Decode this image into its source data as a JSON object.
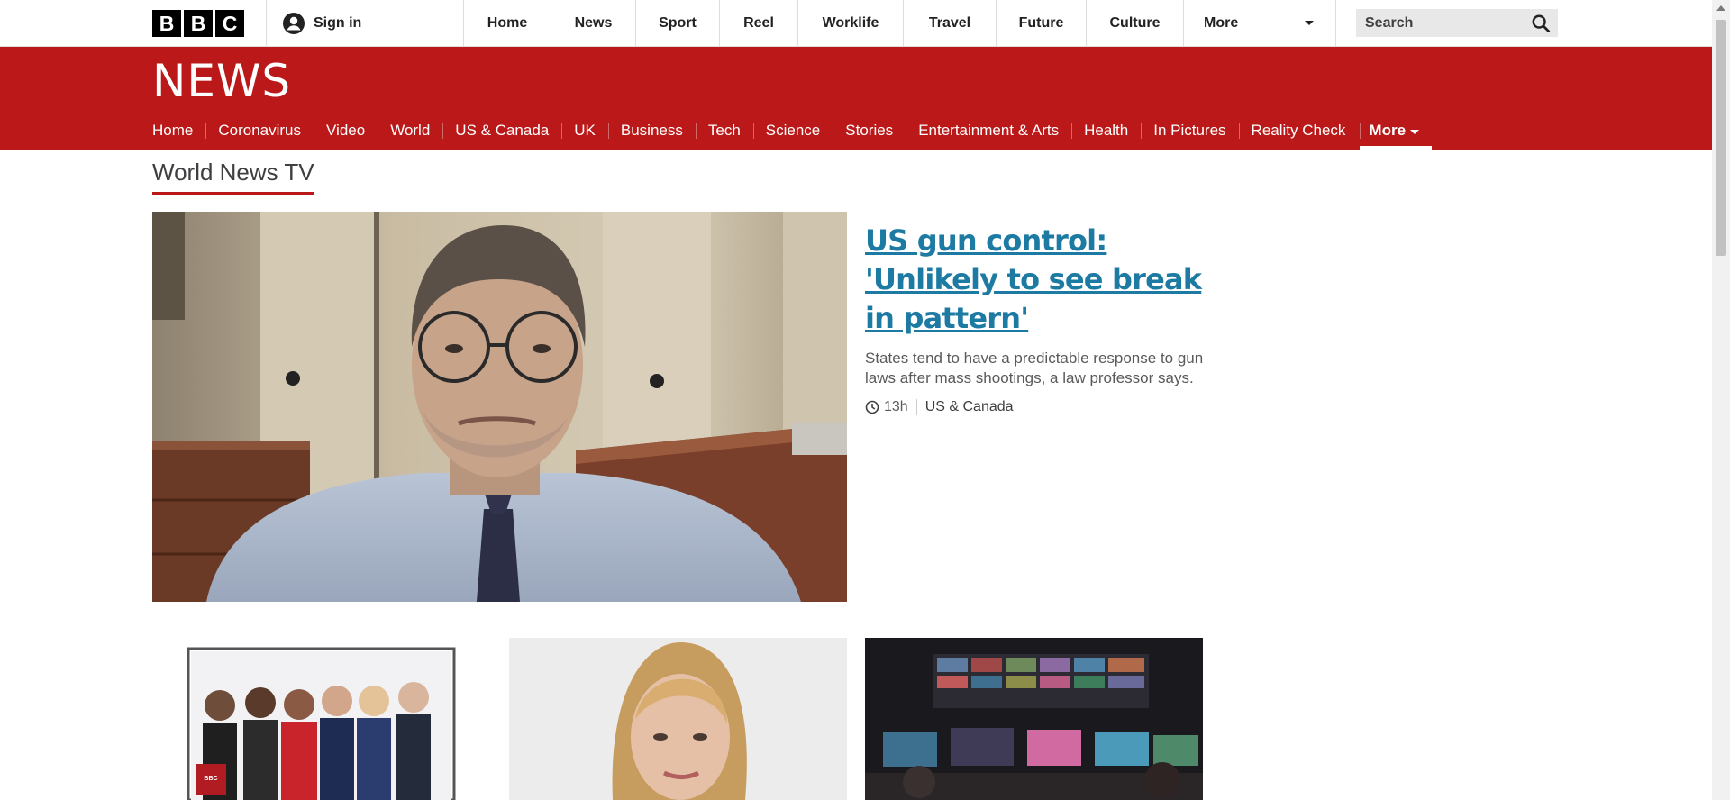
{
  "topbar": {
    "logo_letters": [
      "B",
      "B",
      "C"
    ],
    "sign_in": "Sign in",
    "nav": [
      "Home",
      "News",
      "Sport",
      "Reel",
      "Worklife",
      "Travel",
      "Future",
      "Culture"
    ],
    "more": "More",
    "search_placeholder": "Search"
  },
  "news": {
    "wordmark": "NEWS",
    "nav": [
      "Home",
      "Coronavirus",
      "Video",
      "World",
      "US & Canada",
      "UK",
      "Business",
      "Tech",
      "Science",
      "Stories",
      "Entertainment & Arts",
      "Health",
      "In Pictures",
      "Reality Check"
    ],
    "more": "More"
  },
  "section_title": "World News TV",
  "lead": {
    "headline": "US gun control: 'Unlikely to see break in pattern'",
    "summary": "States tend to have a predictable response to gun laws after mass shootings, a law professor says.",
    "time": "13h",
    "section": "US & Canada"
  },
  "icons": {
    "search": "search-icon",
    "user": "user-icon",
    "clock": "clock-icon"
  },
  "colors": {
    "news_red": "#bb1919",
    "headline_link": "#1d7aa3"
  }
}
